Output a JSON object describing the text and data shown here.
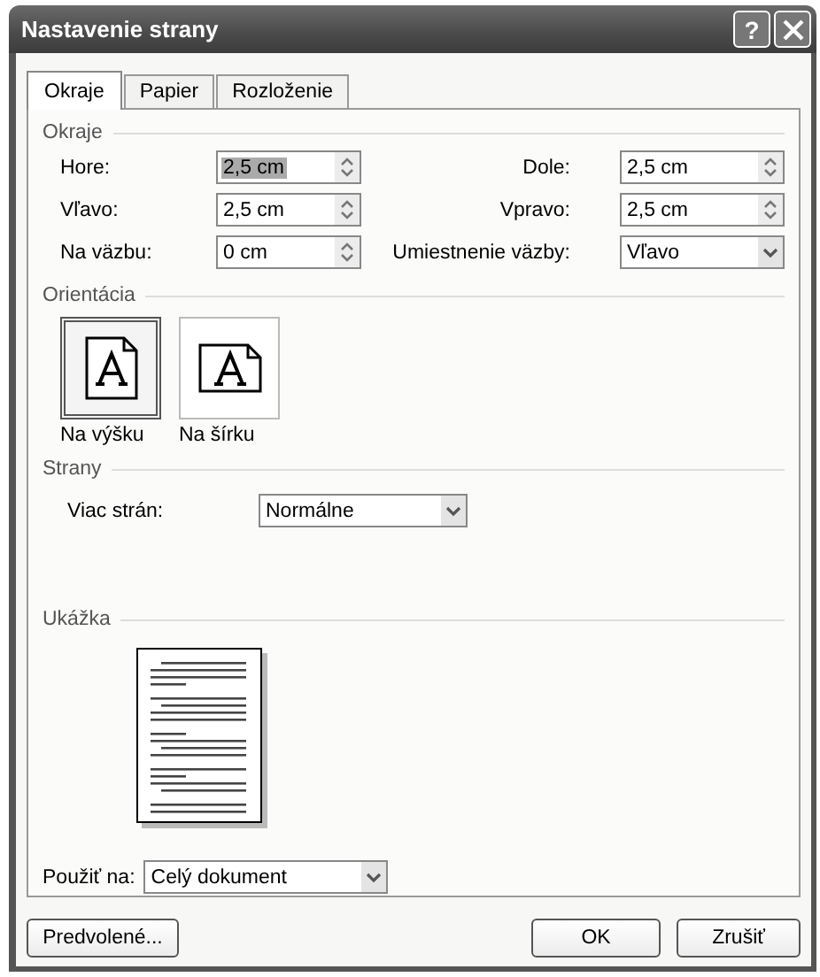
{
  "window": {
    "title": "Nastavenie strany",
    "help": "?"
  },
  "tabs": [
    {
      "label": "Okraje",
      "selected": true
    },
    {
      "label": "Papier",
      "selected": false
    },
    {
      "label": "Rozloženie",
      "selected": false
    }
  ],
  "margins": {
    "heading": "Okraje",
    "fields": [
      {
        "label": "Hore:",
        "value": "2,5 cm",
        "kind": "spin",
        "text_selected": true
      },
      {
        "label": "Dole:",
        "value": "2,5 cm",
        "kind": "spin",
        "text_selected": false
      },
      {
        "label": "Vľavo:",
        "value": "2,5 cm",
        "kind": "spin",
        "text_selected": false
      },
      {
        "label": "Vpravo:",
        "value": "2,5 cm",
        "kind": "spin",
        "text_selected": false
      },
      {
        "label": "Na väzbu:",
        "value": "0 cm",
        "kind": "spin",
        "text_selected": false
      },
      {
        "label": "Umiestnenie väzby:",
        "value": "Vľavo",
        "kind": "dropdown",
        "text_selected": false
      }
    ]
  },
  "orientation": {
    "heading": "Orientácia",
    "options": [
      {
        "label": "Na výšku",
        "kind": "portrait",
        "selected": true
      },
      {
        "label": "Na šírku",
        "kind": "landscape",
        "selected": false
      }
    ]
  },
  "pages": {
    "heading": "Strany",
    "label": "Viac strán:",
    "value": "Normálne"
  },
  "preview": {
    "heading": "Ukážka"
  },
  "apply_to": {
    "label": "Použiť na:",
    "value": "Celý dokument"
  },
  "buttons": [
    "Predvolené...",
    "OK",
    "Zrušiť"
  ]
}
